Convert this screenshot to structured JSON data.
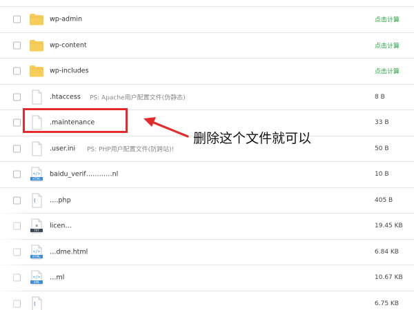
{
  "files": [
    {
      "name": "wp-admin",
      "type": "folder",
      "note": "",
      "size": "点击计算",
      "size_is_link": true
    },
    {
      "name": "wp-content",
      "type": "folder",
      "note": "",
      "size": "点击计算",
      "size_is_link": true
    },
    {
      "name": "wp-includes",
      "type": "folder",
      "note": "",
      "size": "点击计算",
      "size_is_link": true
    },
    {
      "name": ".htaccess",
      "type": "file",
      "note": "PS: Apache用户配置文件(伪静态)",
      "size": "8 B",
      "size_is_link": false
    },
    {
      "name": ".maintenance",
      "type": "file",
      "note": "",
      "size": "33 B",
      "size_is_link": false
    },
    {
      "name": ".user.ini",
      "type": "file",
      "note": "PS: PHP用户配置文件(防跨站)!",
      "size": "50 B",
      "size_is_link": false
    },
    {
      "name": "baidu_verif…………nl",
      "type": "html",
      "note": "",
      "size": "10 B",
      "size_is_link": false
    },
    {
      "name": "….php",
      "type": "php",
      "note": "",
      "size": "405 B",
      "size_is_link": false
    },
    {
      "name": "licen…",
      "type": "txt",
      "note": "",
      "size": "19.45 KB",
      "size_is_link": false
    },
    {
      "name": "…dme.html",
      "type": "html",
      "note": "",
      "size": "6.84 KB",
      "size_is_link": false
    },
    {
      "name": "…ml",
      "type": "xml",
      "note": "",
      "size": "10.67 KB",
      "size_is_link": false
    },
    {
      "name": "",
      "type": "php",
      "note": "",
      "size": "6.75 KB",
      "size_is_link": false
    }
  ],
  "annotation": {
    "text": "删除这个文件就可以"
  },
  "colors": {
    "folder": "#f7cd5a",
    "link_green": "#20a53a",
    "highlight_red": "#e52a2a",
    "html_badge": "#3a8fd8",
    "xml_badge": "#3a8fd8",
    "txt_badge": "#3d4a5c"
  }
}
